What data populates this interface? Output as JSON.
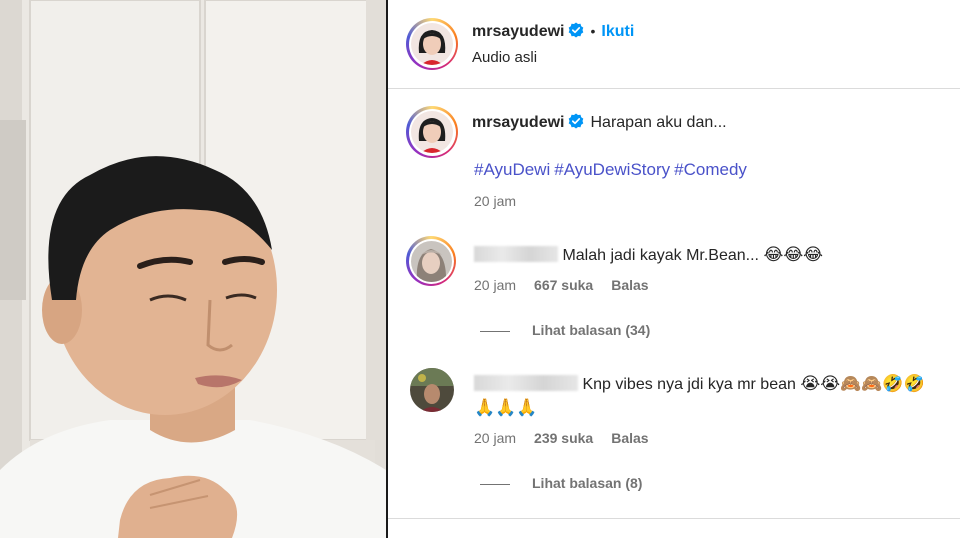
{
  "header": {
    "username": "mrsayudewi",
    "follow_label": "Ikuti",
    "separator": "•",
    "audio_label": "Audio asli"
  },
  "post": {
    "username": "mrsayudewi",
    "caption": "Harapan aku dan...",
    "hashtags": [
      "#AyuDewi",
      "#AyuDewiStory",
      "#Comedy"
    ],
    "time": "20 jam"
  },
  "comments": [
    {
      "text": "Malah jadi kayak Mr.Bean...",
      "emojis": "😂😂😂",
      "time": "20 jam",
      "likes": "667 suka",
      "reply_label": "Balas",
      "view_replies": "Lihat balasan (34)"
    },
    {
      "text": "Knp vibes nya jdi kya mr bean",
      "emojis": "😭😭🙈🙈🤣🤣",
      "emojis_line2": "🙏🙏🙏",
      "time": "20 jam",
      "likes": "239 suka",
      "reply_label": "Balas",
      "view_replies": "Lihat balasan (8)"
    }
  ],
  "colors": {
    "verified": "#0095f6",
    "follow": "#0095f6",
    "hashtag": "#4a52c9",
    "muted": "#737373"
  }
}
